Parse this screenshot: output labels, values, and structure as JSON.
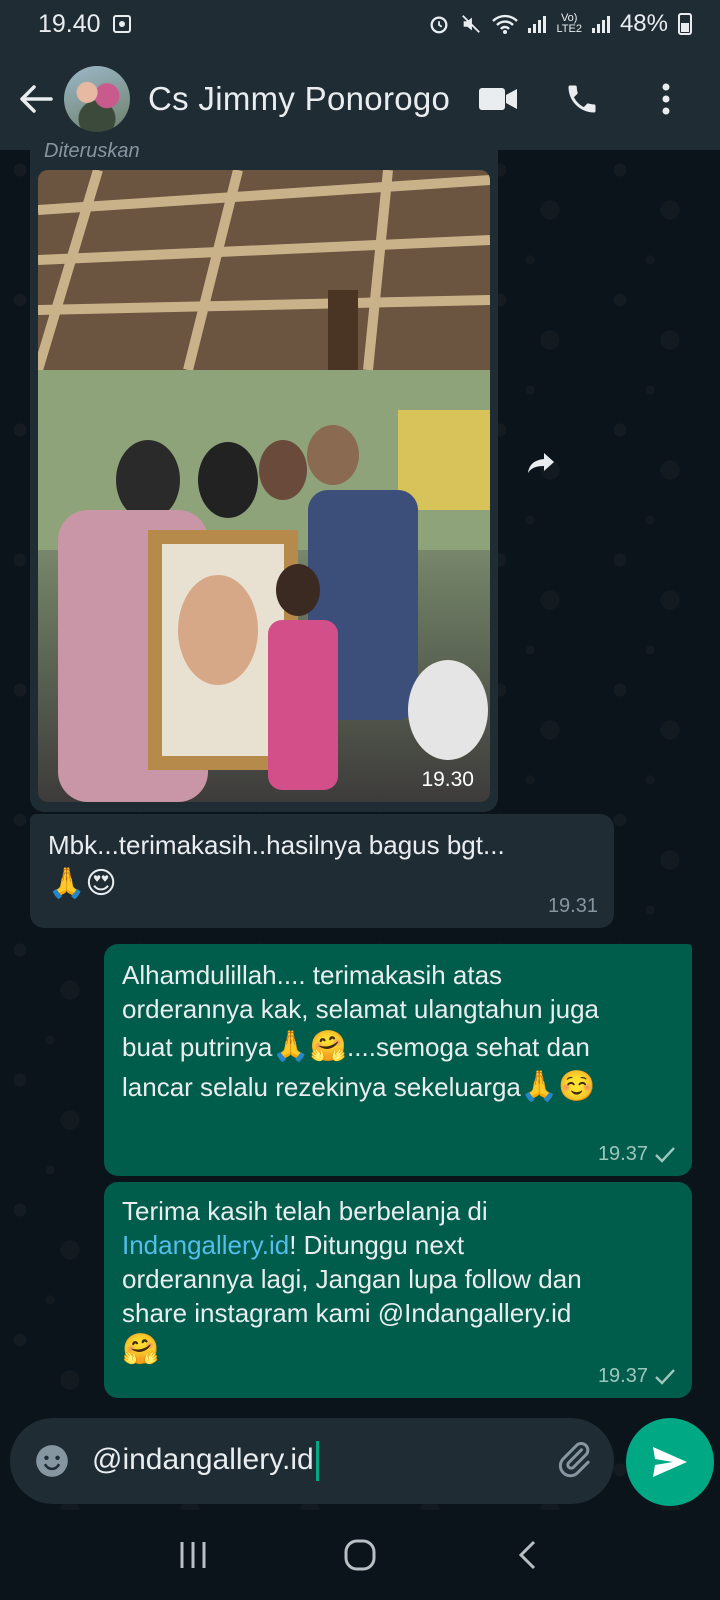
{
  "status_bar": {
    "time": "19.40",
    "network_label": "LTE2",
    "volte_label": "Vo)",
    "battery_percent": "48%"
  },
  "header": {
    "contact_name": "Cs Jimmy Ponorogo"
  },
  "messages": [
    {
      "type": "image",
      "direction": "incoming",
      "forwarded_label": "Diteruskan",
      "time": "19.30"
    },
    {
      "type": "text",
      "direction": "incoming",
      "text": "Mbk...terimakasih..hasilnya bagus bgt...",
      "emoji": "🙏😍",
      "time": "19.31"
    },
    {
      "type": "text",
      "direction": "outgoing",
      "text_lines": [
        "Alhamdulillah....  terimakasih atas",
        "orderannya kak, selamat ulangtahun juga",
        "buat putrinya",
        "....semoga sehat dan",
        "lancar selalu rezekinya sekeluarga"
      ],
      "emoji_1": "🙏🤗",
      "emoji_2": "🙏☺️",
      "time": "19.37"
    },
    {
      "type": "text",
      "direction": "outgoing",
      "line1": "Terima kasih telah berbelanja di",
      "link": "Indangallery.id",
      "line2_rest": "! Ditunggu next",
      "line3": "orderannya lagi, Jangan lupa   follow dan",
      "line4": "share instagram kami @Indangallery.id",
      "emoji": "🤗",
      "time": "19.37"
    }
  ],
  "composer": {
    "value": "@indangallery.id"
  },
  "colors": {
    "background": "#0b141a",
    "incoming_bubble": "#1f2c34",
    "outgoing_bubble": "#005c4b",
    "accent": "#00a884",
    "link": "#53bdeb"
  },
  "icons": [
    "back-arrow-icon",
    "video-call-icon",
    "phone-icon",
    "more-vert-icon",
    "forward-icon",
    "emoji-icon",
    "attach-icon",
    "send-icon",
    "check-icon",
    "recents-icon",
    "home-icon",
    "nav-back-icon"
  ]
}
